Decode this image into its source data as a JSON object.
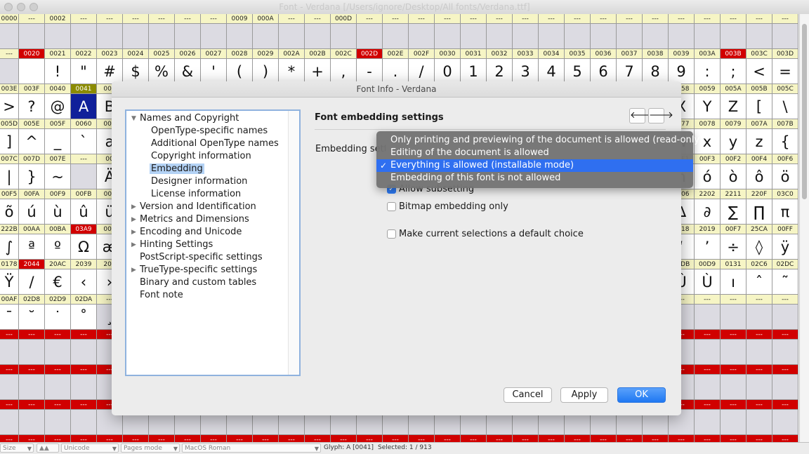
{
  "window": {
    "title": "Font - Verdana [/Users/ignore/Desktop/All fonts/Verdana.ttf]"
  },
  "grid": {
    "rows": [
      {
        "headers": [
          "0000",
          "---",
          "0002",
          "---",
          "---",
          "---",
          "---",
          "---",
          "---",
          "0009",
          "000A",
          "---",
          "---",
          "000D",
          "---",
          "---",
          "---",
          "---",
          "---",
          "---",
          "---",
          "---",
          "---",
          "---",
          "---",
          "---",
          "---",
          "---",
          "---",
          "---",
          "---"
        ],
        "glyphs": [
          "",
          "",
          "",
          "",
          "",
          "",
          "",
          "",
          "",
          "",
          "",
          "",
          "",
          "",
          "",
          "",
          "",
          "",
          "",
          "",
          "",
          "",
          "",
          "",
          "",
          "",
          "",
          "",
          "",
          "",
          ""
        ],
        "empty": true
      },
      {
        "headers": [
          "---",
          "0020",
          "0021",
          "0022",
          "0023",
          "0024",
          "0025",
          "0026",
          "0027",
          "0028",
          "0029",
          "002A",
          "002B",
          "002C",
          "002D",
          "002E",
          "002F",
          "0030",
          "0031",
          "0032",
          "0033",
          "0034",
          "0035",
          "0036",
          "0037",
          "0038",
          "0039",
          "003A",
          "003B",
          "003C",
          "003D"
        ],
        "glyphs": [
          "",
          " ",
          "!",
          "\"",
          "#",
          "$",
          "%",
          "&",
          "'",
          "(",
          ")",
          "*",
          "+",
          ",",
          "-",
          ".",
          "/",
          "0",
          "1",
          "2",
          "3",
          "4",
          "5",
          "6",
          "7",
          "8",
          "9",
          ":",
          ";",
          "<",
          "="
        ]
      },
      {
        "headers": [
          "003E",
          "003F",
          "0040",
          "0041",
          "004"
        ],
        "glyphs": [
          ">",
          "?",
          "@",
          "A",
          "B"
        ],
        "right_headers": [
          "0058",
          "0059",
          "005A",
          "005B",
          "005C"
        ],
        "right_glyphs": [
          "X",
          "Y",
          "Z",
          "[",
          "\\"
        ]
      },
      {
        "headers": [
          "005D",
          "005E",
          "005F",
          "0060",
          "006"
        ],
        "glyphs": [
          "]",
          "^",
          "_",
          "`",
          "a"
        ],
        "right_headers": [
          "0077",
          "0078",
          "0079",
          "007A",
          "007B"
        ],
        "right_glyphs": [
          "w",
          "x",
          "y",
          "z",
          "{"
        ]
      },
      {
        "headers": [
          "007C",
          "007D",
          "007E",
          "---",
          "00"
        ],
        "glyphs": [
          "|",
          "}",
          "~",
          "",
          "Ä"
        ],
        "right_headers": [
          "00F1",
          "00F3",
          "00F2",
          "00F4",
          "00F6"
        ],
        "right_glyphs": [
          "ñ",
          "ó",
          "ò",
          "ô",
          "ö"
        ]
      },
      {
        "headers": [
          "00F5",
          "00FA",
          "00F9",
          "00FB",
          "00F"
        ],
        "glyphs": [
          "õ",
          "ú",
          "ù",
          "û",
          "ü"
        ],
        "right_headers": [
          "2206",
          "2202",
          "2211",
          "220F",
          "03C0"
        ],
        "right_glyphs": [
          "∆",
          "∂",
          "∑",
          "∏",
          "π"
        ]
      },
      {
        "headers": [
          "222B",
          "00AA",
          "00BA",
          "03A9",
          "00E"
        ],
        "glyphs": [
          "∫",
          "ª",
          "º",
          "Ω",
          "æ"
        ],
        "right_headers": [
          "2018",
          "2019",
          "00F7",
          "25CA",
          "00FF"
        ],
        "right_glyphs": [
          "‘",
          "’",
          "÷",
          "◊",
          "ÿ"
        ]
      },
      {
        "headers": [
          "0178",
          "2044",
          "20AC",
          "2039",
          "203"
        ],
        "glyphs": [
          "Ÿ",
          "/",
          "€",
          "‹",
          "›"
        ],
        "right_headers": [
          "00DB",
          "00D9",
          "0131",
          "02C6",
          "02DC"
        ],
        "right_glyphs": [
          "Û",
          "Ù",
          "ı",
          "ˆ",
          "˜"
        ]
      },
      {
        "headers": [
          "00AF",
          "02D8",
          "02D9",
          "02DA",
          "---"
        ],
        "glyphs": [
          "¯",
          "˘",
          "˙",
          "˚",
          "¸"
        ],
        "right_headers": [
          "---",
          "---",
          "---",
          "---",
          "---"
        ],
        "right_glyphs": [
          "",
          "",
          "",
          "",
          ""
        ]
      }
    ]
  },
  "dialog": {
    "title": "Font Info - Verdana",
    "tree": [
      {
        "label": "Names and Copyright",
        "level": 0,
        "expanded": true
      },
      {
        "label": "OpenType-specific names",
        "level": 1
      },
      {
        "label": "Additional OpenType names",
        "level": 1
      },
      {
        "label": "Copyright information",
        "level": 1
      },
      {
        "label": "Embedding",
        "level": 1,
        "selected": true
      },
      {
        "label": "Designer information",
        "level": 1
      },
      {
        "label": "License information",
        "level": 1
      },
      {
        "label": "Version and Identification",
        "level": 0,
        "collapsed": true
      },
      {
        "label": "Metrics and Dimensions",
        "level": 0,
        "collapsed": true
      },
      {
        "label": "Encoding and Unicode",
        "level": 0,
        "collapsed": true
      },
      {
        "label": "Hinting Settings",
        "level": 0,
        "collapsed": true
      },
      {
        "label": "PostScript-specific settings",
        "level": 0
      },
      {
        "label": "TrueType-specific settings",
        "level": 0,
        "collapsed": true
      },
      {
        "label": "Binary and custom tables",
        "level": 0
      },
      {
        "label": "Font note",
        "level": 0
      }
    ],
    "section_title": "Font embedding settings",
    "nav_prev": "🡐",
    "nav_next": "🡒",
    "embedding_label": "Embedding settings:",
    "dropdown_options": [
      "Only printing and previewing of the document is allowed (read-only)",
      "Editing of the document is allowed",
      "Everything is allowed (installable mode)",
      "Embedding of this font is not allowed"
    ],
    "selected_option_index": 2,
    "checkmark": "✓",
    "checkboxes": {
      "allow_subsetting": {
        "label": "Allow subsetting",
        "checked": true
      },
      "bitmap_only": {
        "label": "Bitmap embedding only",
        "checked": false
      },
      "default_choice": {
        "label": "Make current selections a default choice",
        "checked": false
      }
    },
    "buttons": {
      "cancel": "Cancel",
      "apply": "Apply",
      "ok": "OK"
    }
  },
  "statusbar": {
    "size": "Size",
    "encoding": "Unicode",
    "mode": "Pages mode",
    "codepage": "MacOS Roman",
    "glyph_info": "Glyph: A [0041]",
    "selection": "Selected: 1 / 913"
  },
  "colors": {
    "accent": "#2f6ff0",
    "header_red": "#d10000",
    "header_yellow": "#f6f5c5"
  }
}
